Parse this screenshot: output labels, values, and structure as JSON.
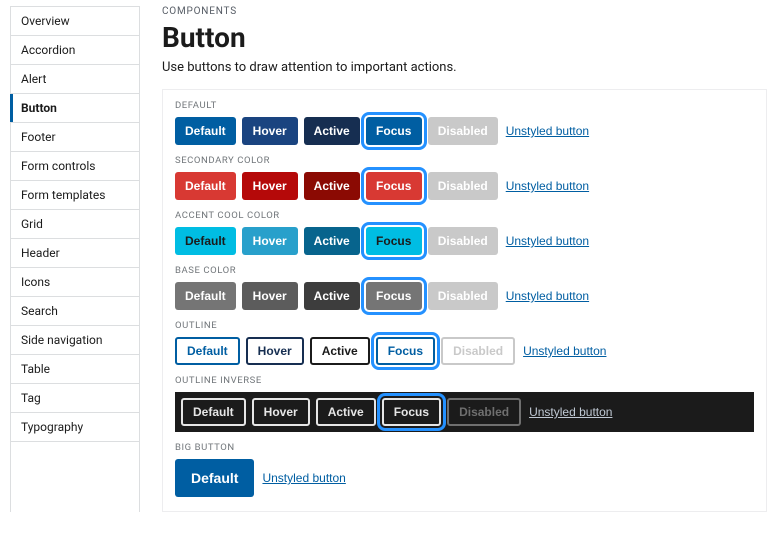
{
  "sidenav": {
    "items": [
      "Overview",
      "Accordion",
      "Alert",
      "Button",
      "Footer",
      "Form controls",
      "Form templates",
      "Grid",
      "Header",
      "Icons",
      "Search",
      "Side navigation",
      "Table",
      "Tag",
      "Typography"
    ],
    "active_index": 3
  },
  "page": {
    "eyebrow": "COMPONENTS",
    "title": "Button",
    "lead": "Use buttons to draw attention to important actions."
  },
  "state_labels": {
    "default": "Default",
    "hover": "Hover",
    "active": "Active",
    "focus": "Focus",
    "disabled": "Disabled"
  },
  "unstyled_label": "Unstyled button",
  "groups": [
    {
      "key": "default",
      "label": "DEFAULT",
      "variant": "v-default",
      "states": [
        "default",
        "hover",
        "active",
        "focus",
        "disabled"
      ],
      "inverse": false
    },
    {
      "key": "secondary",
      "label": "SECONDARY COLOR",
      "variant": "v-secondary",
      "states": [
        "default",
        "hover",
        "active",
        "focus",
        "disabled"
      ],
      "inverse": false
    },
    {
      "key": "cool",
      "label": "ACCENT COOL COLOR",
      "variant": "v-cool",
      "states": [
        "default",
        "hover",
        "active",
        "focus",
        "disabled"
      ],
      "inverse": false
    },
    {
      "key": "base",
      "label": "BASE COLOR",
      "variant": "v-base",
      "states": [
        "default",
        "hover",
        "active",
        "focus",
        "disabled"
      ],
      "inverse": false
    },
    {
      "key": "outline",
      "label": "OUTLINE",
      "variant": "v-outline",
      "states": [
        "default",
        "hover",
        "active",
        "focus",
        "disabled"
      ],
      "inverse": false
    },
    {
      "key": "outline-inverse",
      "label": "OUTLINE INVERSE",
      "variant": "v-outline-inverse",
      "states": [
        "default",
        "hover",
        "active",
        "focus",
        "disabled"
      ],
      "inverse": true
    },
    {
      "key": "big",
      "label": "BIG BUTTON",
      "variant": "v-big",
      "states": [
        "default"
      ],
      "inverse": false
    }
  ]
}
